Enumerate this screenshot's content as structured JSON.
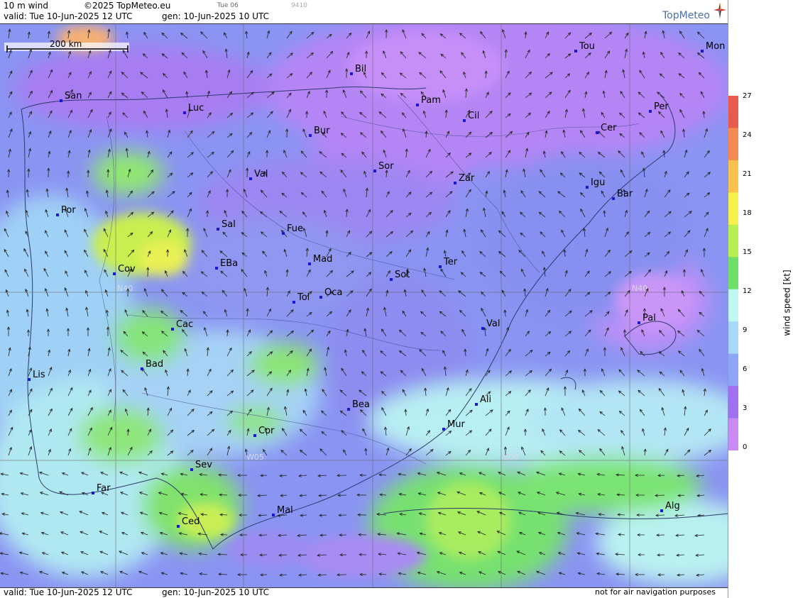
{
  "header": {
    "field": "10 m wind",
    "copyright": "©2025 TopMeteo.eu",
    "valid": "valid:  Tue  10-Jun-2025  12 UTC",
    "gen": "gen: 10-Jun-2025 10 UTC",
    "step": "Tue 06",
    "code": "9410",
    "logo": "TopMeteo"
  },
  "footer": {
    "valid": "valid:  Tue  10-Jun-2025  12 UTC",
    "gen": "gen: 10-Jun-2025 10 UTC",
    "disclaimer": "not for air navigation purposes"
  },
  "scalebar": {
    "label": "200 km"
  },
  "grid_labels": {
    "lat_left": "N40",
    "lat_right": "N40",
    "lon_w05": "W05",
    "lon_e00": "E00",
    "lon_left": "0"
  },
  "legend": {
    "title": "wind speed  [kt]",
    "ticks": [
      "27",
      "24",
      "21",
      "18",
      "15",
      "12",
      "9",
      "6",
      "3",
      "0"
    ],
    "colors": [
      "#e85a4a",
      "#f38a4f",
      "#f8c24c",
      "#f5f04a",
      "#b8ee50",
      "#6ee06a",
      "#bff8f0",
      "#a6d8f8",
      "#8ea4f4",
      "#a070f0",
      "#c98af4"
    ]
  },
  "cities": [
    {
      "label": "San"
    },
    {
      "label": "Luc"
    },
    {
      "label": "Bil"
    },
    {
      "label": "Pam"
    },
    {
      "label": "Tou"
    },
    {
      "label": "Mon"
    },
    {
      "label": "Per"
    },
    {
      "label": "Bur"
    },
    {
      "label": "Cil"
    },
    {
      "label": "Cer"
    },
    {
      "label": "Val"
    },
    {
      "label": "Sor"
    },
    {
      "label": "Zar"
    },
    {
      "label": "Igu"
    },
    {
      "label": "Bar"
    },
    {
      "label": "Por"
    },
    {
      "label": "Sal"
    },
    {
      "label": "Fue"
    },
    {
      "label": "Cov"
    },
    {
      "label": "EBa"
    },
    {
      "label": "Mad"
    },
    {
      "label": "Ter"
    },
    {
      "label": "Sot"
    },
    {
      "label": "Tol"
    },
    {
      "label": "Oca"
    },
    {
      "label": "Cac"
    },
    {
      "label": "Val"
    },
    {
      "label": "Pal"
    },
    {
      "label": "Bad"
    },
    {
      "label": "Lis"
    },
    {
      "label": "Bea"
    },
    {
      "label": "Ali"
    },
    {
      "label": "Mur"
    },
    {
      "label": "Cor"
    },
    {
      "label": "Sev"
    },
    {
      "label": "Far"
    },
    {
      "label": "Mal"
    },
    {
      "label": "Ced"
    },
    {
      "label": "Alg"
    }
  ]
}
